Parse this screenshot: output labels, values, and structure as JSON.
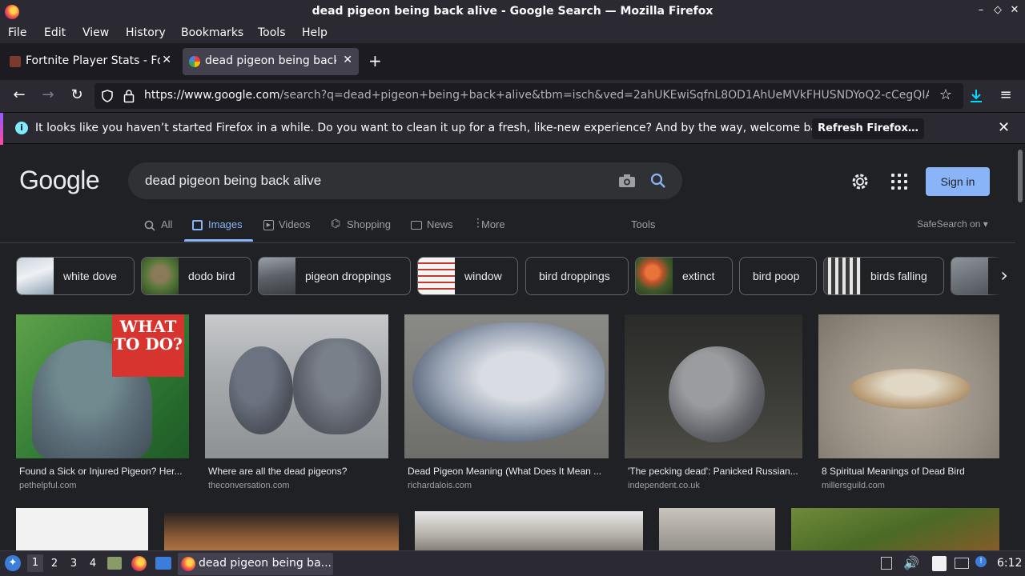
{
  "window": {
    "title": "dead pigeon being back alive - Google Search — Mozilla Firefox"
  },
  "menu": [
    "File",
    "Edit",
    "View",
    "History",
    "Bookmarks",
    "Tools",
    "Help"
  ],
  "tabs": [
    {
      "label": "Fortnite Player Stats - Fo"
    },
    {
      "label": "dead pigeon being back"
    }
  ],
  "address": {
    "host": "https://www.google.com",
    "path": "/search?q=dead+pigeon+being+back+alive&tbm=isch&ved=2ahUKEwiSqfnL8OD1AhUeMVkFHUSNDYoQ2-cCegQIAB"
  },
  "notification": {
    "message": "It looks like you haven’t started Firefox in a while. Do you want to clean it up for a fresh, like-new experience? And by the way, welcome back!",
    "button": "Refresh Firefox…"
  },
  "google": {
    "logo": "Google",
    "query": "dead pigeon being back alive",
    "sign_in": "Sign in",
    "tabs": [
      "All",
      "Images",
      "Videos",
      "Shopping",
      "News",
      "More"
    ],
    "tools": "Tools",
    "safesearch": "SafeSearch on"
  },
  "chips": [
    "white dove",
    "dodo bird",
    "pigeon droppings",
    "window",
    "bird droppings",
    "extinct",
    "bird poop",
    "birds falling"
  ],
  "results": [
    {
      "title": "Found a Sick or Injured Pigeon? Her...",
      "source": "pethelpful.com",
      "overlay": "WHAT TO DO?"
    },
    {
      "title": "Where are all the dead pigeons?",
      "source": "theconversation.com"
    },
    {
      "title": "Dead Pigeon Meaning (What Does It Mean ...",
      "source": "richardalois.com"
    },
    {
      "title": "'The pecking dead': Panicked Russian...",
      "source": "independent.co.uk"
    },
    {
      "title": "8 Spiritual Meanings of Dead Bird",
      "source": "millersguild.com"
    }
  ],
  "taskbar": {
    "workspaces": [
      "1",
      "2",
      "3",
      "4"
    ],
    "window_label": "dead pigeon being ba...",
    "clock": "6:12"
  },
  "colors": {
    "accent": "#8ab4f8",
    "page_bg": "#202124",
    "chrome_bg": "#2b2a33"
  }
}
